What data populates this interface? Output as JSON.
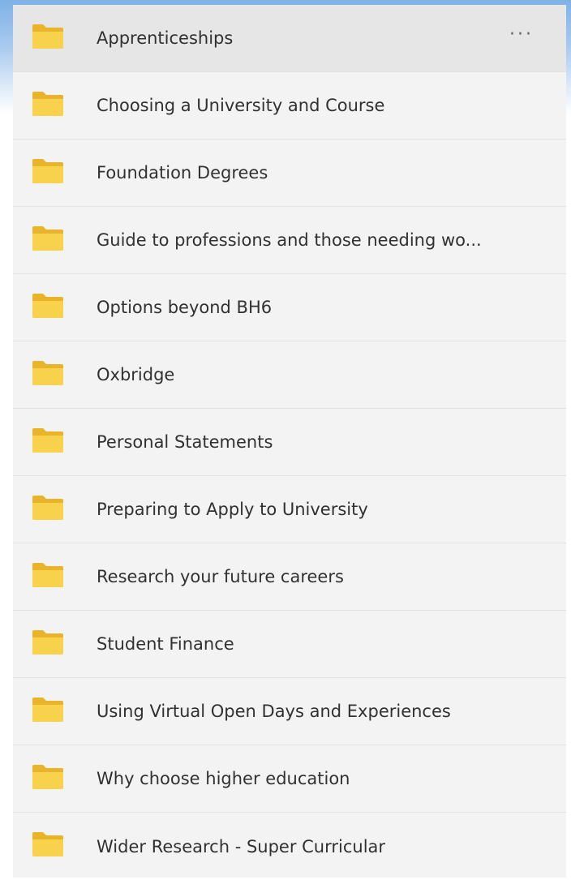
{
  "folder_icon_color": "#f3c83b",
  "folders": [
    {
      "label": "Apprenticeships",
      "more_label": "···"
    },
    {
      "label": "Choosing a University and Course"
    },
    {
      "label": "Foundation Degrees"
    },
    {
      "label": "Guide to professions and those needing wo..."
    },
    {
      "label": "Options beyond BH6"
    },
    {
      "label": "Oxbridge"
    },
    {
      "label": "Personal Statements"
    },
    {
      "label": "Preparing to Apply to University"
    },
    {
      "label": "Research your future careers"
    },
    {
      "label": "Student Finance"
    },
    {
      "label": "Using Virtual Open Days and Experiences"
    },
    {
      "label": "Why choose higher education"
    },
    {
      "label": "Wider Research - Super Curricular"
    }
  ]
}
